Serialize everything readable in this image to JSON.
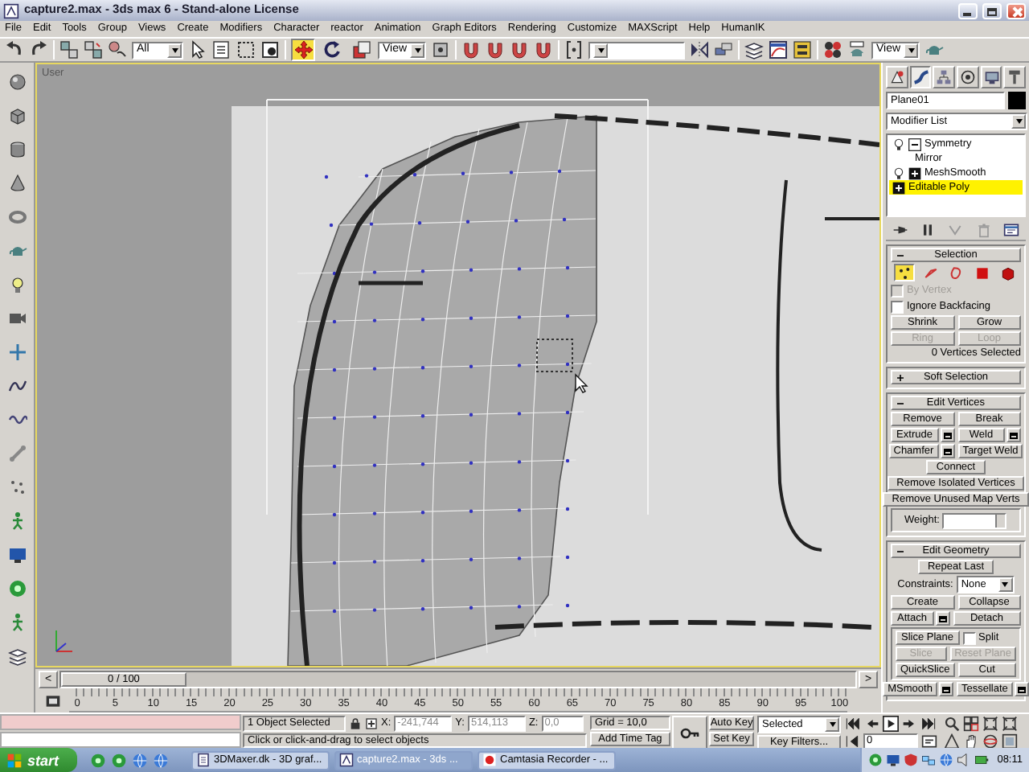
{
  "window": {
    "title": "capture2.max - 3ds max 6 - Stand-alone License"
  },
  "menu": [
    "File",
    "Edit",
    "Tools",
    "Group",
    "Views",
    "Create",
    "Modifiers",
    "Character",
    "reactor",
    "Animation",
    "Graph Editors",
    "Rendering",
    "Customize",
    "MAXScript",
    "Help",
    "HumanIK"
  ],
  "toolbar": {
    "selection_filter": "All",
    "transform_tools": [
      {
        "kind": "move",
        "selected": true
      },
      {
        "kind": "rotate",
        "selected": false
      },
      {
        "kind": "scale",
        "selected": false
      }
    ],
    "coordinate_system": "View",
    "render_mode": "View"
  },
  "viewport": {
    "label": "User"
  },
  "command_panel": {
    "tabs": [
      {
        "kind": "create",
        "selected": false
      },
      {
        "kind": "modify",
        "selected": true
      },
      {
        "kind": "hierarchy",
        "selected": false
      },
      {
        "kind": "motion",
        "selected": false
      },
      {
        "kind": "display",
        "selected": false
      },
      {
        "kind": "utilities",
        "selected": false
      }
    ],
    "object_name": "Plane01",
    "modifier_list": "Modifier List",
    "stack": [
      {
        "kind": "modifier",
        "name": "Symmetry",
        "expanded": true,
        "selected": false,
        "children": [
          {
            "name": "Mirror",
            "selected": false
          }
        ]
      },
      {
        "kind": "modifier",
        "name": "MeshSmooth",
        "expanded": false,
        "selected": false
      },
      {
        "kind": "base",
        "name": "Editable Poly",
        "expanded": false,
        "selected": true
      }
    ],
    "rollouts": [
      {
        "title": "Selection",
        "expanded": true,
        "levels": [
          {
            "kind": "vertex",
            "selected": true
          },
          {
            "kind": "edge",
            "selected": false
          },
          {
            "kind": "border",
            "selected": false
          },
          {
            "kind": "polygon",
            "selected": false
          },
          {
            "kind": "element",
            "selected": false
          }
        ],
        "checks": [
          {
            "label": "By Vertex",
            "checked": false,
            "disabled": true
          },
          {
            "label": "Ignore Backfacing",
            "checked": false,
            "disabled": false
          }
        ],
        "rows": [
          {
            "kind": "buttons",
            "items": [
              {
                "label": "Shrink",
                "disabled": false,
                "settings": false
              },
              {
                "label": "Grow",
                "disabled": false,
                "settings": false
              }
            ]
          },
          {
            "kind": "buttons",
            "items": [
              {
                "label": "Ring",
                "disabled": true,
                "settings": false
              },
              {
                "label": "Loop",
                "disabled": true,
                "settings": false
              }
            ]
          }
        ],
        "status": "0 Vertices Selected"
      },
      {
        "title": "Soft Selection",
        "expanded": false
      },
      {
        "title": "Edit Vertices",
        "expanded": true,
        "rows": [
          {
            "kind": "buttons",
            "items": [
              {
                "label": "Remove",
                "disabled": false,
                "settings": false
              },
              {
                "label": "Break",
                "disabled": false,
                "settings": false
              }
            ]
          },
          {
            "kind": "buttons",
            "items": [
              {
                "label": "Extrude",
                "disabled": false,
                "settings": true
              },
              {
                "label": "Weld",
                "disabled": false,
                "settings": true
              }
            ]
          },
          {
            "kind": "buttons",
            "items": [
              {
                "label": "Chamfer",
                "disabled": false,
                "settings": true
              },
              {
                "label": "Target Weld",
                "disabled": false,
                "settings": false
              }
            ]
          },
          {
            "kind": "buttons",
            "items": [
              {
                "label": "Connect",
                "disabled": false,
                "settings": false
              }
            ]
          },
          {
            "kind": "buttons",
            "items": [
              {
                "label": "Remove Isolated Vertices",
                "disabled": false,
                "settings": false
              }
            ]
          },
          {
            "kind": "buttons",
            "items": [
              {
                "label": "Remove Unused Map Verts",
                "disabled": false,
                "settings": false
              }
            ]
          },
          {
            "kind": "group",
            "rows": [
              {
                "kind": "spinner",
                "label": "Weight:"
              }
            ]
          }
        ]
      },
      {
        "title": "Edit Geometry",
        "expanded": true,
        "rows": [
          {
            "kind": "buttons",
            "items": [
              {
                "label": "Repeat Last",
                "disabled": false,
                "settings": false
              }
            ]
          },
          {
            "kind": "dropdown",
            "label": "Constraints:",
            "value": "None"
          },
          {
            "kind": "buttons",
            "items": [
              {
                "label": "Create",
                "disabled": false,
                "settings": false
              },
              {
                "label": "Collapse",
                "disabled": false,
                "settings": false
              }
            ]
          },
          {
            "kind": "buttons",
            "items": [
              {
                "label": "Attach",
                "disabled": false,
                "settings": true
              },
              {
                "label": "Detach",
                "disabled": false,
                "settings": false
              }
            ]
          },
          {
            "kind": "group",
            "rows": [
              {
                "kind": "button_check",
                "button": "Slice Plane",
                "check": {
                  "label": "Split",
                  "checked": false
                }
              },
              {
                "kind": "buttons",
                "items": [
                  {
                    "label": "Slice",
                    "disabled": true,
                    "settings": false
                  },
                  {
                    "label": "Reset Plane",
                    "disabled": true,
                    "settings": false
                  }
                ]
              },
              {
                "kind": "buttons",
                "items": [
                  {
                    "label": "QuickSlice",
                    "disabled": false,
                    "settings": false
                  },
                  {
                    "label": "Cut",
                    "disabled": false,
                    "settings": false
                  }
                ]
              }
            ]
          },
          {
            "kind": "buttons",
            "items": [
              {
                "label": "MSmooth",
                "disabled": false,
                "settings": true
              },
              {
                "label": "Tessellate",
                "disabled": false,
                "settings": true
              }
            ]
          }
        ]
      }
    ]
  },
  "time_slider": {
    "previous": "<",
    "position": "0 / 100",
    "next": ">",
    "level": 0
  },
  "track_bar": {
    "ticks": [
      "0",
      "5",
      "10",
      "15",
      "20",
      "25",
      "30",
      "35",
      "40",
      "45",
      "50",
      "55",
      "60",
      "65",
      "70",
      "75",
      "80",
      "85",
      "90",
      "95",
      "100"
    ]
  },
  "status": {
    "selection": "1 Object Selected",
    "coordinates": [
      {
        "label": "X:",
        "value": "-241,744"
      },
      {
        "label": "Y:",
        "value": "514,113"
      },
      {
        "label": "Z:",
        "value": "0,0"
      }
    ],
    "prompt": "Click or click-and-drag to select objects",
    "grid": "Grid = 10,0",
    "time_tag": "Add Time Tag"
  },
  "animation": {
    "auto_key": {
      "label": "Auto Key",
      "on": false
    },
    "key_mode": "Selected",
    "set_key": "Set Key",
    "key_filters": "Key Filters...",
    "frame": "0"
  },
  "taskbar": {
    "start": "start",
    "tasks": [
      {
        "label": "3DMaxer.dk - 3D graf...",
        "selected": false
      },
      {
        "label": "capture2.max - 3ds ...",
        "selected": true
      },
      {
        "label": "Camtasia Recorder - ...",
        "selected": false
      }
    ],
    "clock": "08:11"
  }
}
